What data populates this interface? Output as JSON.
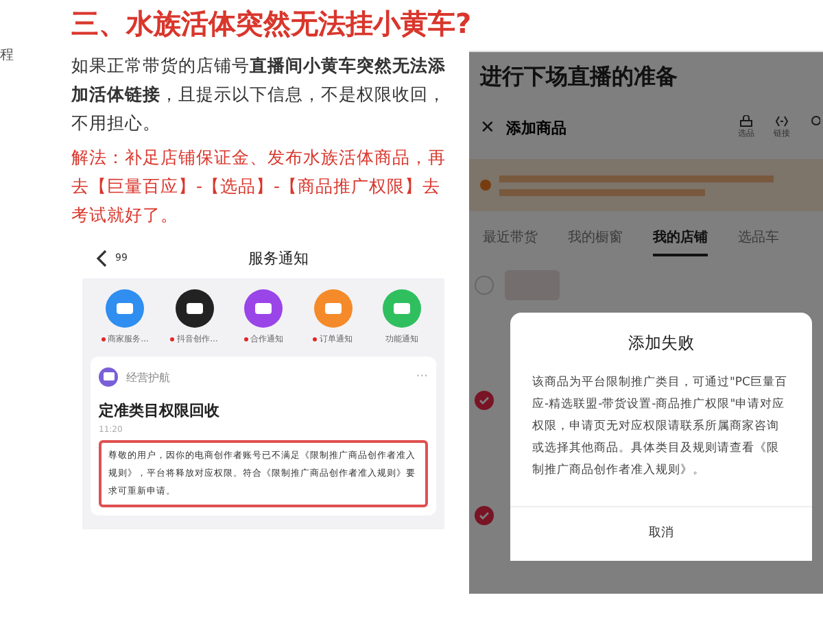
{
  "margin_fragment": "程",
  "article": {
    "heading": "三、水族活体突然无法挂小黄车?",
    "paragraph": "如果正常带货的店铺号**直播间小黄车突然无法添加活体链接**，且提示以下信息，不是权限收回，不用担心。",
    "solution": "解法：补足店铺保证金、发布水族活体商品，再去【巨量百应】-【选品】-【商品推广权限】去考试就好了。"
  },
  "notice_screen": {
    "back_count": "99",
    "title": "服务通知",
    "shortcuts": [
      {
        "label": "商家服务...",
        "unread": true,
        "color": "#2f8ef0"
      },
      {
        "label": "抖音创作...",
        "unread": true,
        "color": "#222222"
      },
      {
        "label": "合作通知",
        "unread": true,
        "color": "#9a45e8"
      },
      {
        "label": "订单通知",
        "unread": true,
        "color": "#f58a2a"
      },
      {
        "label": "功能通知",
        "unread": false,
        "color": "#2fbf5f"
      }
    ],
    "card": {
      "source": "经营护航",
      "menu": "···",
      "title": "定准类目权限回收",
      "time": "11:20",
      "message": "尊敬的用户，因你的电商创作者账号已不满足《限制推广商品创作者准入规则》，平台将释放对应权限。符合《限制推广商品创作者准入规则》要求可重新申请。"
    }
  },
  "live_screen": {
    "title": "进行下场直播的准备",
    "header": "添加商品",
    "close": "✕",
    "tools": [
      {
        "label": "选品"
      },
      {
        "label": "链接"
      }
    ],
    "tabs": [
      {
        "label": "最近带货",
        "selected": false
      },
      {
        "label": "我的橱窗",
        "selected": false
      },
      {
        "label": "我的店铺",
        "selected": true
      },
      {
        "label": "选品车",
        "selected": false
      }
    ],
    "rows": [
      {
        "checked": false
      },
      {
        "checked": true
      },
      {
        "checked": true
      }
    ],
    "dialog": {
      "title": "添加失败",
      "message": "该商品为平台限制推广类目，可通过\"PC巨量百应-精选联盟-带货设置-商品推广权限\"申请对应权限，申请页无对应权限请联系所属商家咨询或选择其他商品。具体类目及规则请查看《限制推广商品创作者准入规则》。",
      "cancel": "取消"
    }
  }
}
